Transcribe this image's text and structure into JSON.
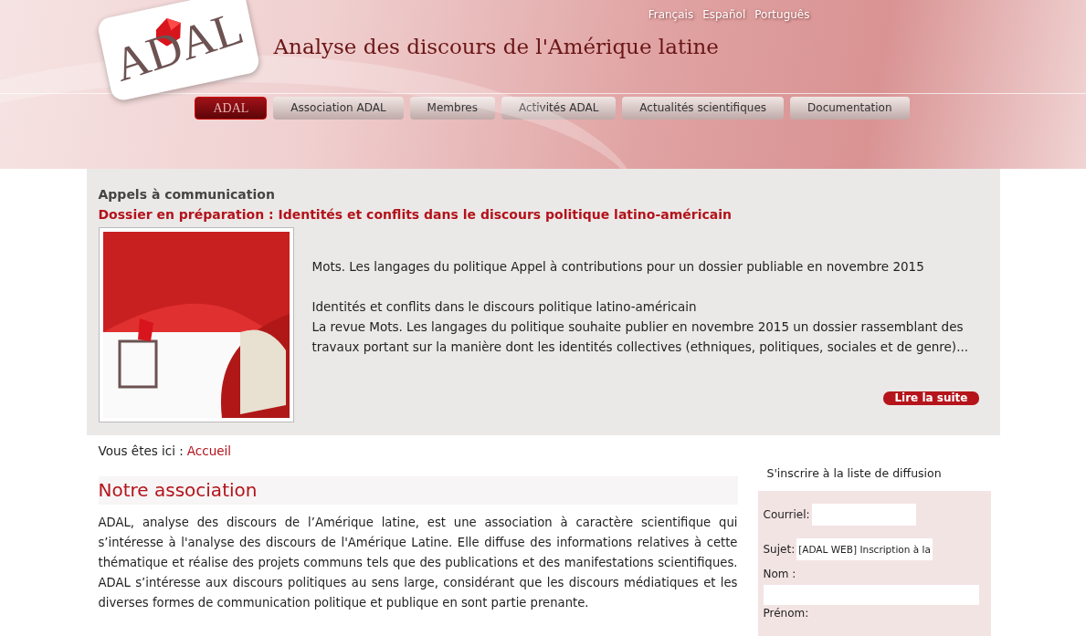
{
  "languages": [
    "Français",
    "Español",
    "Português"
  ],
  "logo": {
    "text": "ADAL"
  },
  "site_title": "Analyse des discours de l'Amérique latine",
  "nav": [
    {
      "label": "ADAL",
      "selected": true
    },
    {
      "label": "Association ADAL",
      "selected": false
    },
    {
      "label": "Membres",
      "selected": false
    },
    {
      "label": "Activités ADAL",
      "selected": false
    },
    {
      "label": "Actualités scientifiques",
      "selected": false
    },
    {
      "label": "Documentation",
      "selected": false
    }
  ],
  "feature": {
    "category": "Appels à communication",
    "title": "Dossier en préparation : Identités et conflits dans le discours politique latino-américain",
    "paragraphs": [
      "Mots. Les langages du politique Appel à contributions pour un dossier publiable en novembre 2015",
      "Identités et conflits dans le discours politique latino-américain",
      "La revue Mots. Les langages du politique souhaite publier en novembre 2015 un dossier rassemblant des travaux portant sur la manière dont les identités collectives (ethniques, politiques, sociales et de genre)..."
    ],
    "read_more": "Lire la suite"
  },
  "breadcrumb": {
    "label": "Vous êtes ici :",
    "link": "Accueil"
  },
  "article": {
    "heading": "Notre association",
    "body": "ADAL, analyse des discours de l’Amérique latine, est une association à caractère scientifique qui s’intéresse à l'analyse des discours de l'Amérique Latine. Elle diffuse des informations relatives à cette thématique et réalise des projets communs tels que des publications et des manifestations scientifiques. ADAL s’intéresse aux discours politiques au sens large, considérant que les discours médiatiques et les diverses formes de communication politique et publique en sont partie prenante."
  },
  "sidebar": {
    "title": "S'inscrire à la liste de diffusion",
    "fields": [
      {
        "label": "Courriel:",
        "kind": "inline"
      },
      {
        "label": "Sujet:",
        "kind": "inline",
        "value": "[ADAL WEB] Inscription à la"
      },
      {
        "label": "Nom :",
        "kind": "stacked"
      },
      {
        "label": "Prénom:",
        "kind": "stacked"
      }
    ]
  }
}
